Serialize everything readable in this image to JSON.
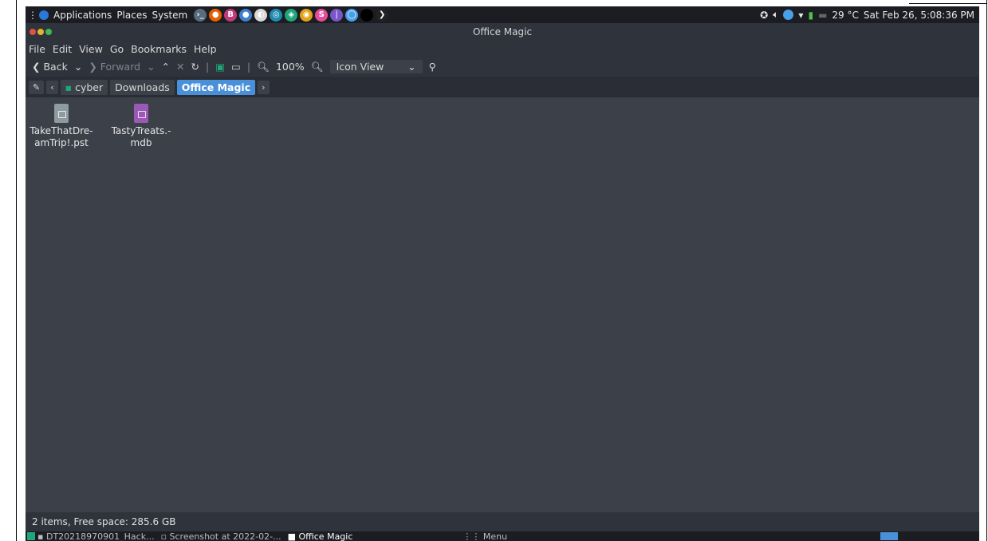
{
  "panel": {
    "menus": [
      "Applications",
      "Places",
      "System"
    ],
    "launchers": [
      {
        "icon": "terminal-icon",
        "color": "#5a6b7b",
        "glyph": "›_"
      },
      {
        "icon": "firefox-icon",
        "color": "#e66000",
        "glyph": "●"
      },
      {
        "icon": "app-icon-pink",
        "color": "#c0397a",
        "glyph": "B"
      },
      {
        "icon": "app-icon-blue",
        "color": "#3f7fd1",
        "glyph": "●"
      },
      {
        "icon": "app-icon-flame",
        "color": "#d9d9d9",
        "glyph": "◐"
      },
      {
        "icon": "app-icon-teal",
        "color": "#1f8ab0",
        "glyph": "◎"
      },
      {
        "icon": "app-icon-green",
        "color": "#1fa67a",
        "glyph": "◈"
      },
      {
        "icon": "chrome-icon",
        "color": "#e0a21b",
        "glyph": "◉"
      },
      {
        "icon": "app-icon-orange",
        "color": "#e24e9b",
        "glyph": "S"
      },
      {
        "icon": "feather-icon",
        "color": "#7a55c8",
        "glyph": "❘"
      },
      {
        "icon": "app-icon-cyan",
        "color": "#4aa0e8",
        "glyph": "◯"
      },
      {
        "icon": "terminal-black-icon",
        "color": "#000000",
        "glyph": ""
      },
      {
        "icon": "app-icon-dark",
        "color": "#222222",
        "glyph": "❯"
      }
    ],
    "weather": "29 °C",
    "clock": "Sat Feb 26, 5:08:36 PM"
  },
  "window": {
    "title": "Office Magic",
    "menus": [
      "File",
      "Edit",
      "View",
      "Go",
      "Bookmarks",
      "Help"
    ],
    "toolbar": {
      "back": "Back",
      "forward": "Forward",
      "zoom": "100%",
      "view_mode": "Icon View"
    },
    "path": [
      "cyber",
      "Downloads",
      "Office Magic"
    ],
    "files": [
      {
        "name": "TakeThatDre-amTrip!.pst",
        "color": "#8e9ba0"
      },
      {
        "name": "TastyTreats.-mdb",
        "color": "#9b59b6"
      }
    ],
    "status": "2 items, Free space: 285.6 GB"
  },
  "taskbar": {
    "items": [
      "DT20218970901_Hack...",
      "Screenshot at 2022-02-...",
      "Office Magic"
    ],
    "menu": "Menu"
  },
  "colors": {
    "accent": "#4a90d9",
    "close": "#e0533d",
    "min": "#e6b32e",
    "max": "#3fb950"
  }
}
